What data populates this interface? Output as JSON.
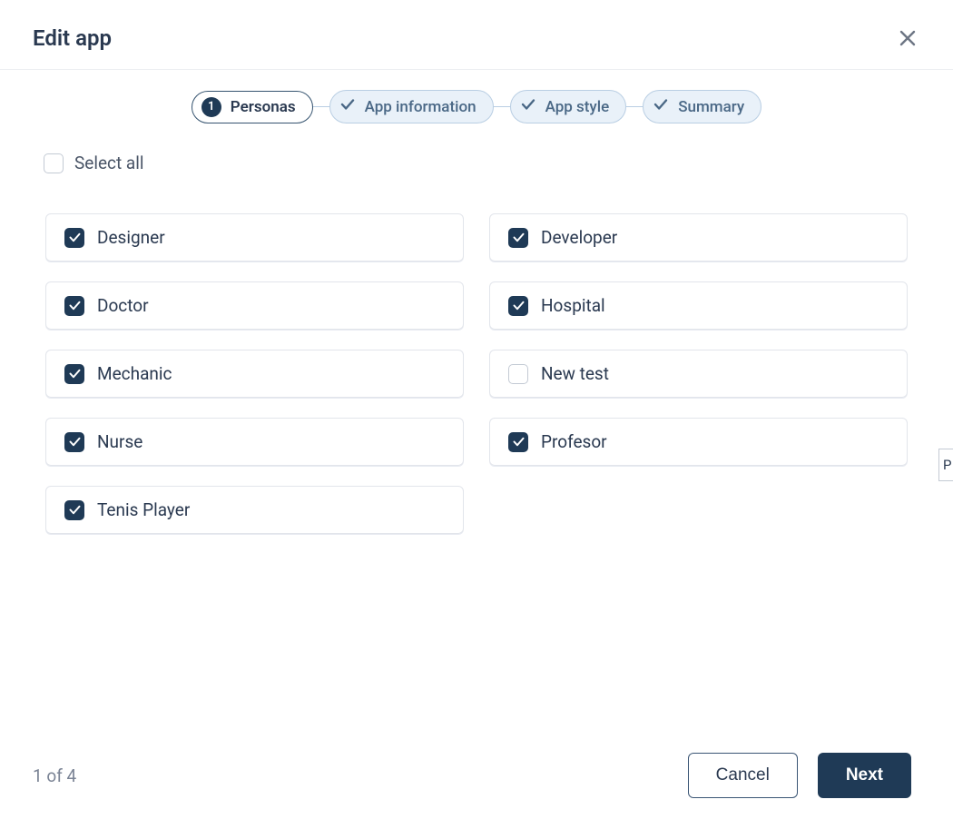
{
  "dialog": {
    "title": "Edit app"
  },
  "stepper": {
    "steps": [
      {
        "label": "Personas",
        "state": "active",
        "number": "1"
      },
      {
        "label": "App information",
        "state": "done"
      },
      {
        "label": "App style",
        "state": "done"
      },
      {
        "label": "Summary",
        "state": "done"
      }
    ]
  },
  "selectAll": {
    "label": "Select all",
    "checked": false
  },
  "personas": [
    {
      "label": "Designer",
      "checked": true
    },
    {
      "label": "Developer",
      "checked": true
    },
    {
      "label": "Doctor",
      "checked": true
    },
    {
      "label": "Hospital",
      "checked": true
    },
    {
      "label": "Mechanic",
      "checked": true
    },
    {
      "label": "New test",
      "checked": false
    },
    {
      "label": "Nurse",
      "checked": true
    },
    {
      "label": "Profesor",
      "checked": true
    },
    {
      "label": "Tenis Player",
      "checked": true
    }
  ],
  "footer": {
    "pageIndicator": "1 of 4",
    "cancel": "Cancel",
    "next": "Next"
  },
  "peek": {
    "text": "P"
  }
}
